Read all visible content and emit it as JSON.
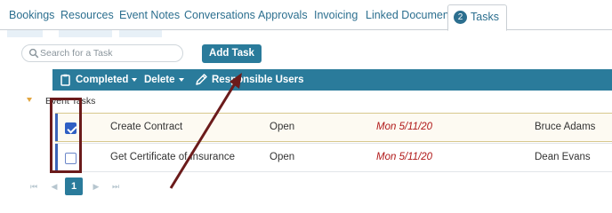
{
  "tabs": [
    {
      "label": "Bookings"
    },
    {
      "label": "Resources"
    },
    {
      "label": "Event Notes"
    },
    {
      "label": "Conversations"
    },
    {
      "label": "Approvals"
    },
    {
      "label": "Invoicing"
    },
    {
      "label": "Linked Documents"
    },
    {
      "label": "Tasks",
      "badge": "2",
      "active": true
    }
  ],
  "search": {
    "placeholder": "Search for a Task"
  },
  "add_task_label": "Add Task",
  "toolbar": {
    "completed_label": "Completed",
    "delete_label": "Delete",
    "responsible_users_label": "Responsible Users"
  },
  "group": {
    "label": "Event Tasks"
  },
  "rows": [
    {
      "name": "Create Contract",
      "status": "Open",
      "due": "Mon 5/11/20",
      "assignee": "Bruce Adams",
      "checked": true
    },
    {
      "name": "Get Certificate of Insurance",
      "status": "Open",
      "due": "Mon 5/11/20",
      "assignee": "Dean Evans",
      "checked": false
    }
  ],
  "pager": {
    "current_page": "1",
    "first": "⏮",
    "prev": "◀",
    "next": "▶",
    "last": "⏭"
  },
  "colors": {
    "accent": "#2a7b9b",
    "annotation": "#6b1b1b",
    "due_date": "#b01818"
  }
}
